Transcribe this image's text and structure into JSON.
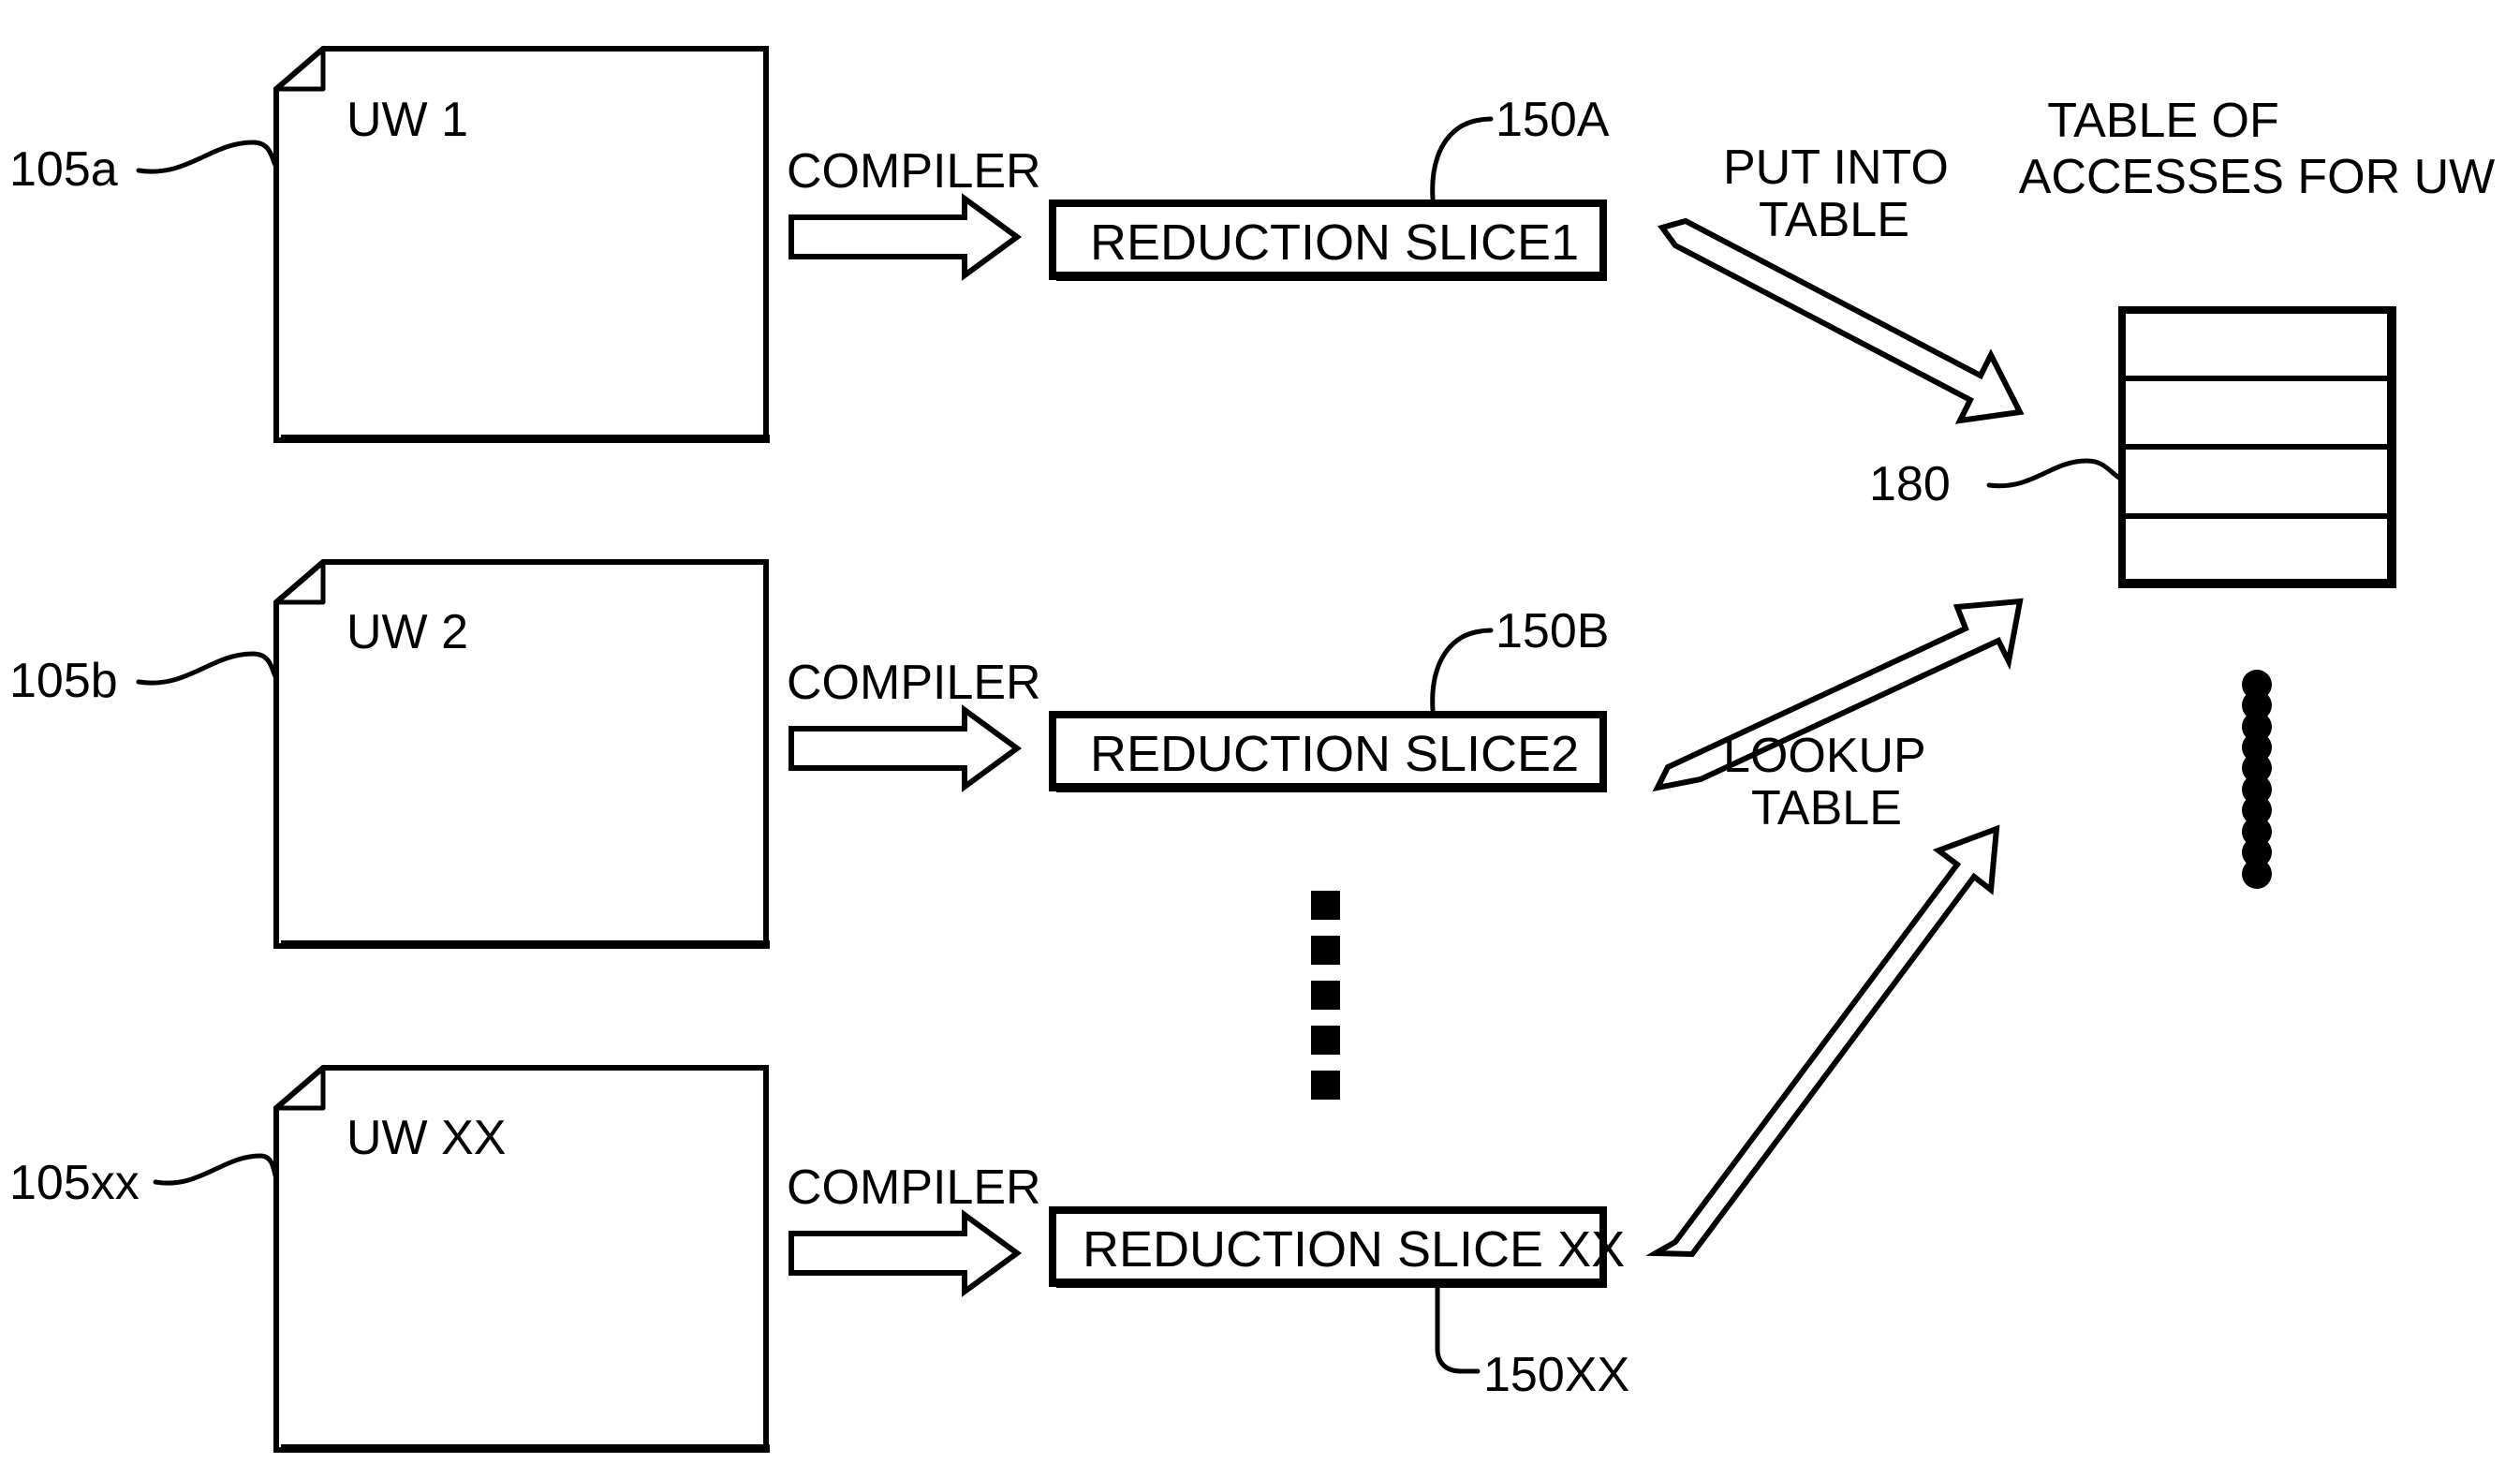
{
  "figure": {
    "title": "Compiler reduction slice to table of accesses flow diagram",
    "background_color": "#ffffff",
    "line_color": "#000000"
  },
  "documents": [
    {
      "label": "UW 1",
      "ref": "105a",
      "name": "uw-1"
    },
    {
      "label": "UW 2",
      "ref": "105b",
      "name": "uw-2"
    },
    {
      "label": "UW XX",
      "ref": "105xx",
      "name": "uw-xx"
    }
  ],
  "compiler_steps": [
    {
      "label": "COMPILER"
    },
    {
      "label": "COMPILER"
    },
    {
      "label": "COMPILER"
    }
  ],
  "reduction_slices": [
    {
      "label": "REDUCTION SLICE1",
      "ref": "150A",
      "name": "reduction-slice-1"
    },
    {
      "label": "REDUCTION SLICE2",
      "ref": "150B",
      "name": "reduction-slice-2"
    },
    {
      "label": "REDUCTION SLICE XX",
      "ref": "150XX",
      "name": "reduction-slice-xx"
    }
  ],
  "flow_arrows": [
    {
      "label_line1": "PUT INTO",
      "label_line2": "TABLE",
      "name": "put-into-table-arrow"
    },
    {
      "label_line1": "LOOKUP",
      "label_line2": "TABLE",
      "name": "lookup-table-arrow"
    }
  ],
  "table": {
    "title_line1": "TABLE OF",
    "title_line2": "ACCESSES FOR UW",
    "ref": "180",
    "row_count": 4,
    "continuation_dots": 10
  },
  "vertical_ellipsis": {
    "square_count": 5
  }
}
